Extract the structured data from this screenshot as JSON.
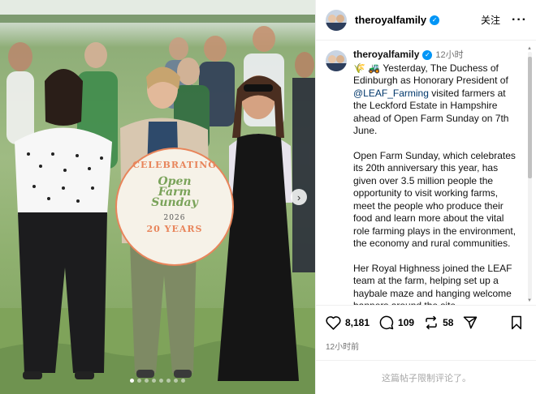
{
  "colors": {
    "verified": "#0095f6",
    "mention": "#00376b",
    "muted": "#737373",
    "logo_orange": "#e8855b",
    "logo_green": "#7aa35a"
  },
  "photo": {
    "badge": {
      "top_text": "CELEBRATING",
      "line1": "Open",
      "line2": "Farm",
      "line3": "Sunday",
      "year": "2026",
      "bottom_text": "20 YEARS"
    },
    "next_icon": "chevron-right-icon",
    "slide_count": 8,
    "current_slide": 1
  },
  "header": {
    "username": "theroyalfamily",
    "follow_label": "关注",
    "more_icon": "more-horizontal-icon"
  },
  "caption": {
    "username": "theroyalfamily",
    "time": "12小时",
    "emoji": "🌾 🚜",
    "p1_before": " Yesterday, The Duchess of Edinburgh as Honorary President of ",
    "mention": "@LEAF_Farming",
    "p1_after": " visited farmers at the Leckford Estate in Hampshire ahead of Open Farm Sunday on 7th June.",
    "p2": "Open Farm Sunday, which celebrates its 20th anniversary this year, has given over 3.5 million people the opportunity to visit working farms, meet the people who produce their food and learn more about the vital role farming plays in the environment, the economy and rural communities.",
    "p3": "Her Royal Highness joined the LEAF team at the farm, helping set up a haybale maze and hanging welcome banners around the site."
  },
  "actions": {
    "likes": "8,181",
    "comments": "109",
    "reposts": "58",
    "post_time": "12小时前"
  },
  "footer": {
    "restricted_text": "这篇帖子限制评论了。"
  }
}
